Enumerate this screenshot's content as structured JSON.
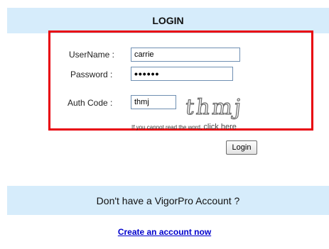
{
  "header": {
    "title": "LOGIN"
  },
  "form": {
    "username_label": "UserName :",
    "username_value": "carrie",
    "password_label": "Password :",
    "password_value": "••••••",
    "authcode_label": "Auth Code :",
    "authcode_value": "thmj",
    "captcha_text": "thmj",
    "hint_text": "If you cannot read the word,",
    "hint_link": "click here",
    "login_button": "Login"
  },
  "promo": {
    "title": "Don't have a VigorPro Account ?",
    "create_link": "Create an account now"
  },
  "colors": {
    "header_bg": "#d6ecfb",
    "frame_border": "#e8000b",
    "link": "#0000cc"
  }
}
